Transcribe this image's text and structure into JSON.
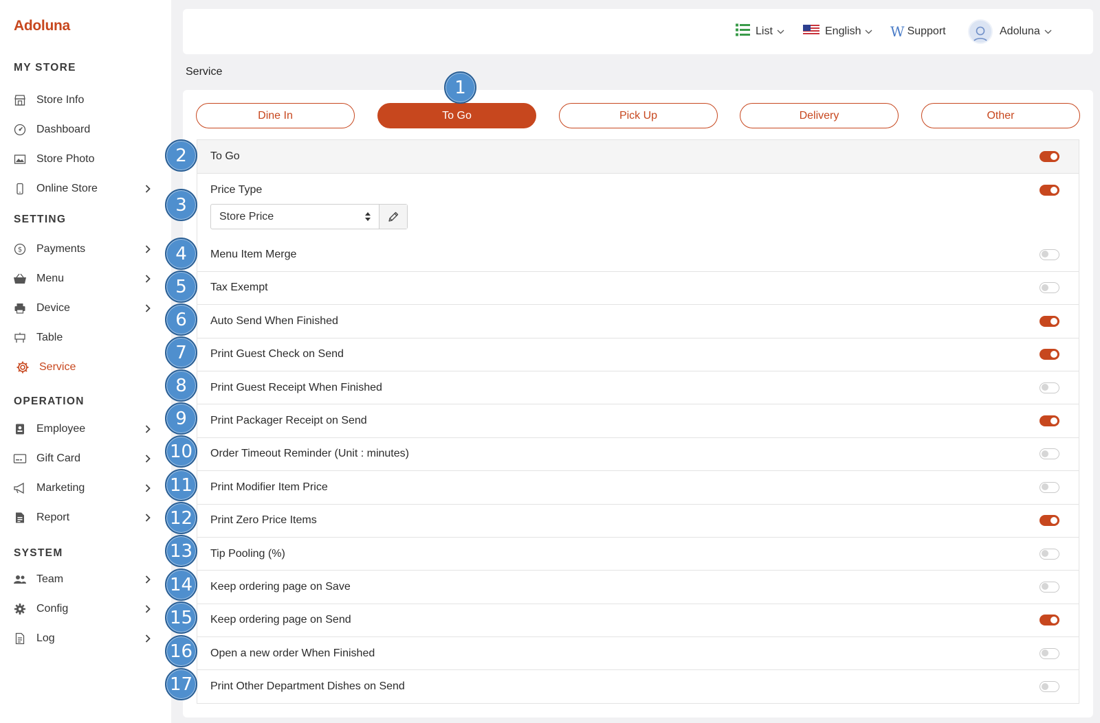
{
  "app": {
    "logo": "Adoluna"
  },
  "sidebar": {
    "sections": [
      {
        "title": "MY STORE"
      },
      {
        "title": "SETTING"
      },
      {
        "title": "OPERATION"
      },
      {
        "title": "SYSTEM"
      }
    ],
    "items": [
      {
        "label": "Store Info",
        "icon": "store-icon"
      },
      {
        "label": "Dashboard",
        "icon": "dashboard-icon"
      },
      {
        "label": "Store Photo",
        "icon": "photo-icon"
      },
      {
        "label": "Online Store",
        "icon": "phone-icon",
        "expandable": true
      },
      {
        "label": "Payments",
        "icon": "dollar-icon",
        "expandable": true
      },
      {
        "label": "Menu",
        "icon": "basket-icon",
        "expandable": true
      },
      {
        "label": "Device",
        "icon": "printer-icon",
        "expandable": true
      },
      {
        "label": "Table",
        "icon": "table-icon"
      },
      {
        "label": "Service",
        "icon": "service-gear-icon",
        "active": true
      },
      {
        "label": "Employee",
        "icon": "badge-icon",
        "expandable": true
      },
      {
        "label": "Gift Card",
        "icon": "giftcard-icon",
        "expandable": true
      },
      {
        "label": "Marketing",
        "icon": "megaphone-icon",
        "expandable": true
      },
      {
        "label": "Report",
        "icon": "report-icon",
        "expandable": true
      },
      {
        "label": "Team",
        "icon": "team-icon",
        "expandable": true
      },
      {
        "label": "Config",
        "icon": "config-gear-icon",
        "expandable": true
      },
      {
        "label": "Log",
        "icon": "log-icon",
        "expandable": true
      }
    ]
  },
  "header": {
    "view_label": "List",
    "language_label": "English",
    "support_label": "Support",
    "user_label": "Adoluna"
  },
  "page": {
    "title": "Service"
  },
  "tabs": [
    {
      "label": "Dine In",
      "active": false
    },
    {
      "label": "To Go",
      "active": true
    },
    {
      "label": "Pick Up",
      "active": false
    },
    {
      "label": "Delivery",
      "active": false
    },
    {
      "label": "Other",
      "active": false
    }
  ],
  "settings": {
    "header": {
      "label": "To Go",
      "on": true
    },
    "price_type": {
      "label": "Price Type",
      "on": true,
      "selected": "Store Price"
    },
    "rows": [
      {
        "label": "Menu Item Merge",
        "on": false
      },
      {
        "label": "Tax Exempt",
        "on": false
      },
      {
        "label": "Auto Send When Finished",
        "on": true
      },
      {
        "label": "Print Guest Check on Send",
        "on": true
      },
      {
        "label": "Print Guest Receipt When Finished",
        "on": false
      },
      {
        "label": "Print Packager Receipt on Send",
        "on": true
      },
      {
        "label": "Order Timeout Reminder (Unit : minutes)",
        "on": false
      },
      {
        "label": "Print Modifier Item Price",
        "on": false
      },
      {
        "label": "Print Zero Price Items",
        "on": true
      },
      {
        "label": "Tip Pooling (%)",
        "on": false
      },
      {
        "label": "Keep ordering page on Save",
        "on": false
      },
      {
        "label": "Keep ordering page on Send",
        "on": true
      },
      {
        "label": "Open a new order When Finished",
        "on": false
      },
      {
        "label": "Print Other Department Dishes on Send",
        "on": false
      }
    ]
  },
  "badges": [
    "1",
    "2",
    "3",
    "4",
    "5",
    "6",
    "7",
    "8",
    "9",
    "10",
    "11",
    "12",
    "13",
    "14",
    "15",
    "16",
    "17"
  ],
  "colors": {
    "accent": "#c7471e",
    "badge": "#4f8fce",
    "badge_border": "#2a5f95"
  }
}
